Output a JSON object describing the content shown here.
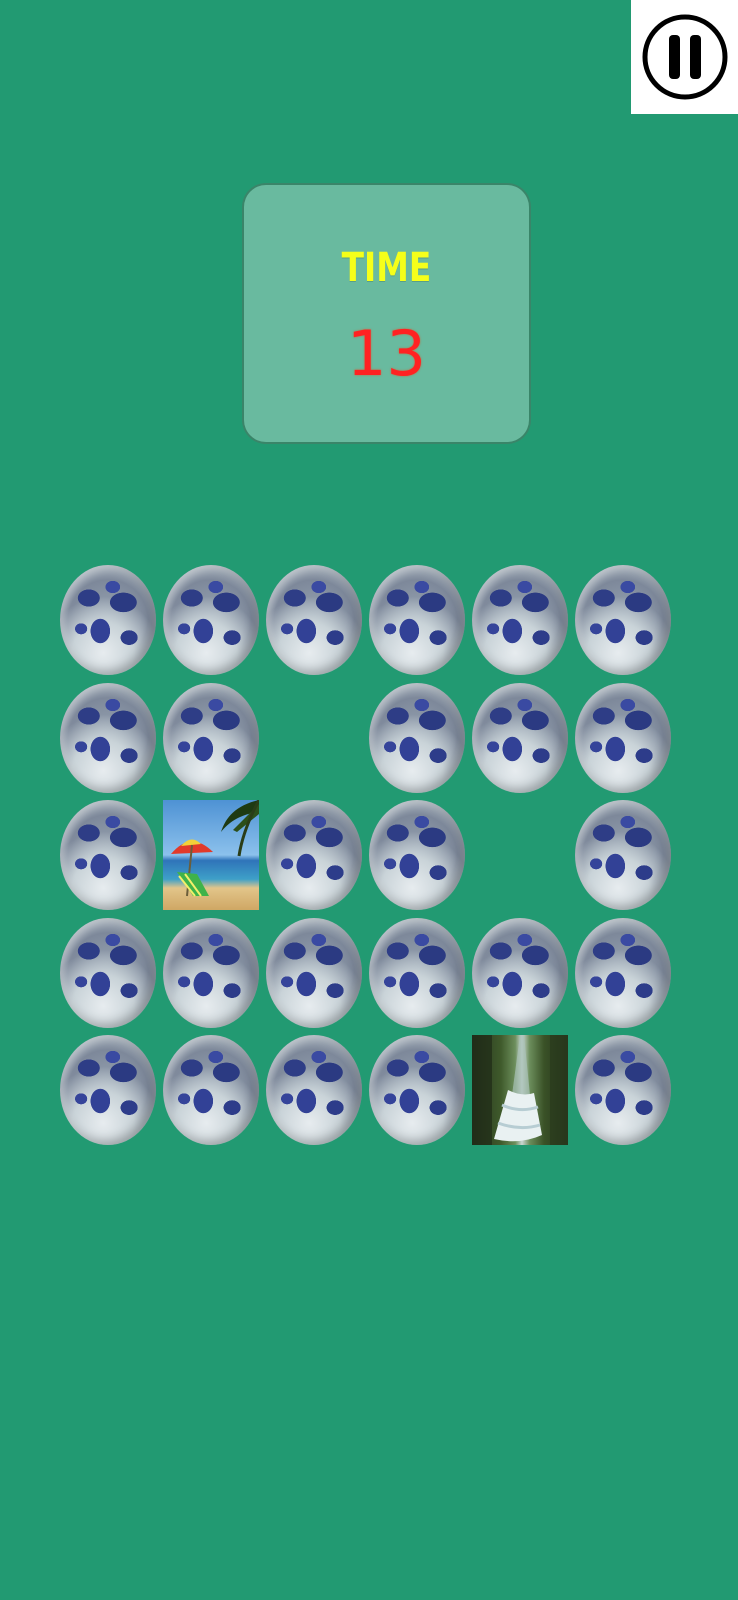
{
  "timer": {
    "label": "TIME",
    "value": "13"
  },
  "controls": {
    "pause_icon": "pause-icon"
  },
  "board": {
    "rows": 5,
    "cols": 6,
    "card_back": "moon",
    "cells": [
      [
        "moon",
        "moon",
        "moon",
        "moon",
        "moon",
        "moon"
      ],
      [
        "moon",
        "moon",
        "empty",
        "moon",
        "moon",
        "moon"
      ],
      [
        "moon",
        "beach",
        "moon",
        "moon",
        "empty",
        "moon"
      ],
      [
        "moon",
        "moon",
        "moon",
        "moon",
        "moon",
        "moon"
      ],
      [
        "moon",
        "moon",
        "moon",
        "moon",
        "waterfall",
        "moon"
      ]
    ]
  },
  "colors": {
    "background": "#229a72",
    "timer_label": "#f5ff1a",
    "timer_value": "#ff2222"
  }
}
